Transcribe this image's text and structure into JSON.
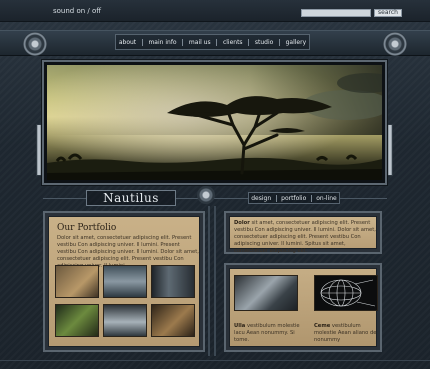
{
  "topbar": {
    "sound_prefix": "",
    "sound_link": "sound on / off",
    "search_value": "",
    "search_button": "search"
  },
  "nav": {
    "items": [
      "about",
      "main info",
      "mail us",
      "clients",
      "studio",
      "gallery"
    ]
  },
  "brand": {
    "name": "Nautilus"
  },
  "sublinks": {
    "items": [
      "design",
      "portfolio",
      "on-line"
    ]
  },
  "portfolio": {
    "title": "Our Portfolio",
    "text": "Dolor sit amet, consectetuer adipiscing elit. Present vestibu Con adipiscing univer. Il lumini. Present vestibu Con adipiscing univer. Il lumini. Dolor sit amet, consectetuer adipiscing elit. Present vestibu Con adipiscing univer. Il lumini."
  },
  "intro": {
    "lead": "Dolor",
    "text": "sit amet, consectetuer adipiscing elit. Present vestibu Con adipiscing univer. Il lumini. Dolor sit amet, consectetuer adipiscing elit. Present vestibu Con adipiscing univer. Il lumini. Spitus sit amet, consectetuer adipiscing elit."
  },
  "features": [
    {
      "lead": "Ulla",
      "text": "vestibulum molestie lacu Aean nonummy. Si tome."
    },
    {
      "lead": "Ceme",
      "text": "vestibulum molestie Aean aliano de nonummy"
    }
  ],
  "colors": {
    "background": "#1e2730",
    "panel_paper": "#c9b188",
    "text_light": "#e3e8ec"
  }
}
